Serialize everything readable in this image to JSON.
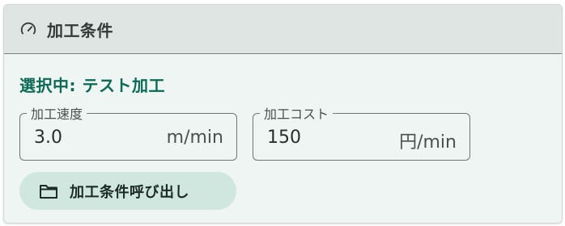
{
  "panel": {
    "header_title": "加工条件",
    "header_icon": "speedometer-icon",
    "selected_text": "選択中: テスト加工"
  },
  "fields": {
    "speed": {
      "label": "加工速度",
      "value": "3.0",
      "unit": "m/min"
    },
    "cost": {
      "label": "加工コスト",
      "value": "150",
      "unit": "円/min"
    }
  },
  "actions": {
    "load_button_label": "加工条件呼び出し",
    "load_button_icon": "folder-icon"
  },
  "colors": {
    "accent_text": "#0b6a55",
    "card_bg": "#eef5f2",
    "header_bg": "#dfe5e2",
    "button_bg": "#cfe7df"
  }
}
